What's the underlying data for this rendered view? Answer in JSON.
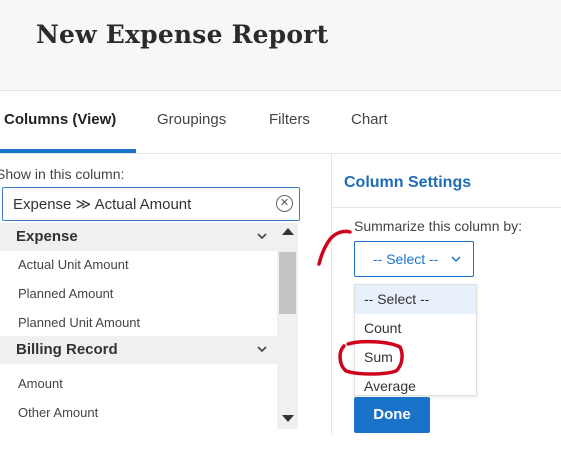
{
  "header": {
    "title": "New Expense Report"
  },
  "tabs": [
    {
      "label": "Columns (View)"
    },
    {
      "label": "Groupings"
    },
    {
      "label": "Filters"
    },
    {
      "label": "Chart"
    }
  ],
  "left": {
    "show_label": "Show in this column:",
    "field_value": "Expense  ≫  Actual Amount",
    "groups": [
      {
        "label": "Expense",
        "items": [
          "Actual Unit Amount",
          "Planned Amount",
          "Planned Unit Amount"
        ]
      },
      {
        "label": "Billing Record",
        "items": [
          "Amount",
          "Other Amount"
        ]
      }
    ]
  },
  "right": {
    "title": "Column Settings",
    "summarize_label": "Summarize this column by:",
    "select_value": "-- Select --",
    "options": [
      "-- Select --",
      "Count",
      "Sum",
      "Average"
    ],
    "done_label": "Done"
  },
  "colors": {
    "accent": "#1a73c9",
    "annotation": "#d0021b"
  }
}
